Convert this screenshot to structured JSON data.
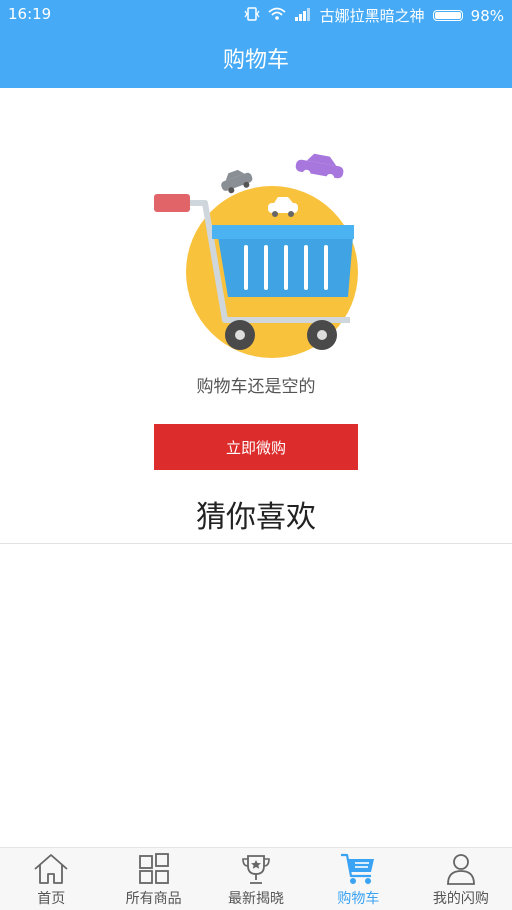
{
  "status_bar": {
    "time": "16:19",
    "carrier": "古娜拉黑暗之神",
    "battery": "98%"
  },
  "header": {
    "title": "购物车"
  },
  "empty_state": {
    "message": "购物车还是空的",
    "button_label": "立即微购"
  },
  "recommend": {
    "title": "猜你喜欢"
  },
  "tabbar": {
    "items": [
      {
        "label": "首页",
        "icon": "home-icon",
        "active": false
      },
      {
        "label": "所有商品",
        "icon": "grid-icon",
        "active": false
      },
      {
        "label": "最新揭晓",
        "icon": "trophy-icon",
        "active": false
      },
      {
        "label": "购物车",
        "icon": "cart-icon",
        "active": true
      },
      {
        "label": "我的闪购",
        "icon": "user-icon",
        "active": false
      }
    ]
  },
  "colors": {
    "primary": "#46aaf6",
    "button": "#dc2c2c",
    "tab_active": "#3aa3f3"
  }
}
